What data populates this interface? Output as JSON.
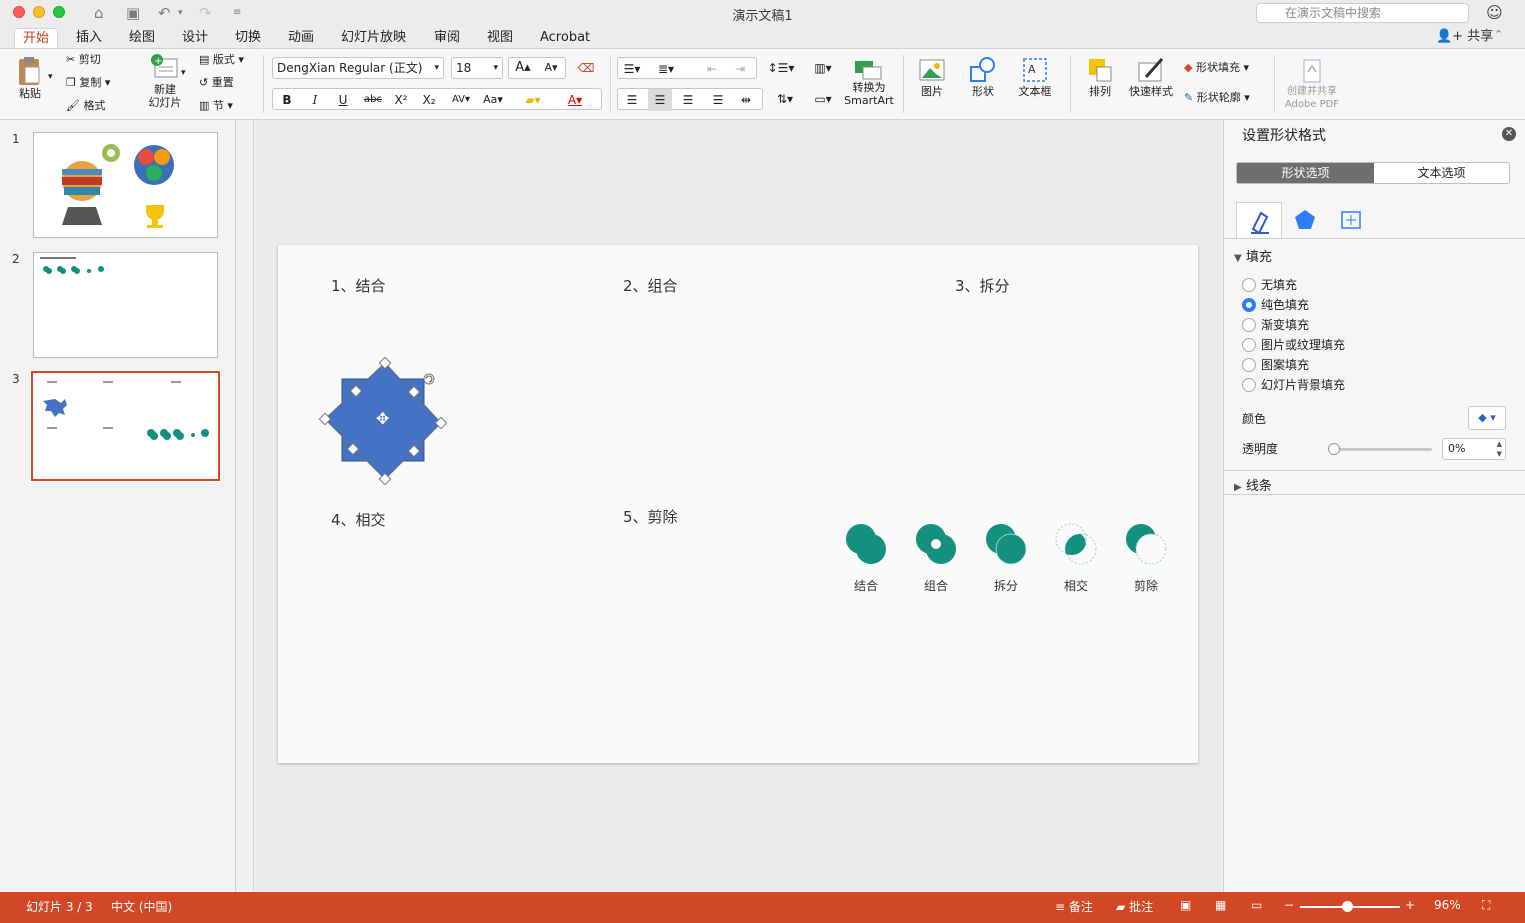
{
  "window": {
    "title": "演示文稿1",
    "search_placeholder": "在演示文稿中搜索"
  },
  "tabs": [
    "开始",
    "插入",
    "绘图",
    "设计",
    "切换",
    "动画",
    "幻灯片放映",
    "审阅",
    "视图",
    "Acrobat"
  ],
  "share_label": "共享",
  "ribbon": {
    "paste": "粘贴",
    "cut": "剪切",
    "copy": "复制",
    "format": "格式",
    "new_slide_1": "新建",
    "new_slide_2": "幻灯片",
    "layout": "版式",
    "reset": "重置",
    "section": "节",
    "font_name": "DengXian Regular (正文)",
    "font_size": "18",
    "convert_1": "转换为",
    "convert_2": "SmartArt",
    "picture": "图片",
    "shape": "形状",
    "textbox": "文本框",
    "arrange": "排列",
    "quick_style": "快速样式",
    "shape_fill": "形状填充",
    "shape_outline": "形状轮廓",
    "adobe_1": "创建并共享",
    "adobe_2": "Adobe PDF"
  },
  "thumbnails": [
    "1",
    "2",
    "3"
  ],
  "slide": {
    "labels": [
      "1、结合",
      "2、组合",
      "3、拆分",
      "4、相交",
      "5、剪除"
    ],
    "circle_captions": [
      "结合",
      "组合",
      "拆分",
      "相交",
      "剪除"
    ]
  },
  "panel": {
    "title": "设置形状格式",
    "tab_shape": "形状选项",
    "tab_text": "文本选项",
    "fill_section": "填充",
    "fill_options": [
      "无填充",
      "纯色填充",
      "渐变填充",
      "图片或纹理填充",
      "图案填充",
      "幻灯片背景填充"
    ],
    "selected_fill": "纯色填充",
    "color_label": "颜色",
    "transparency_label": "透明度",
    "transparency_value": "0%",
    "line_section": "线条"
  },
  "status": {
    "slide": "幻灯片 3 / 3",
    "language": "中文 (中国)",
    "notes": "备注",
    "comments": "批注",
    "zoom": "96%"
  },
  "colors": {
    "accent": "#d24726",
    "teal": "#14917e",
    "shape_blue": "#4472c4"
  }
}
